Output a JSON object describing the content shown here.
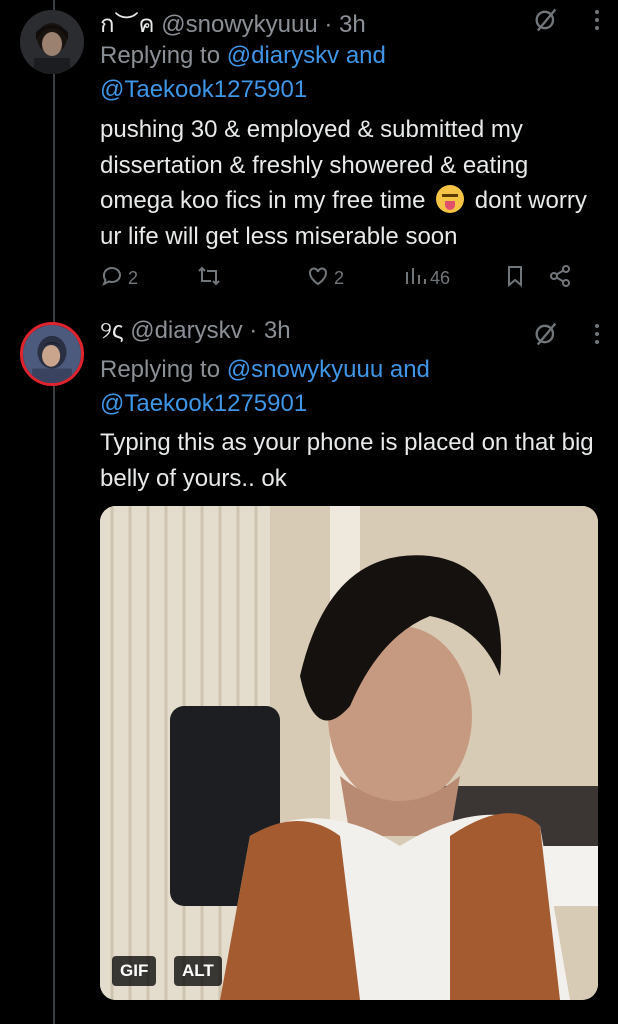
{
  "tweets": [
    {
      "display_name": "ก︶ค",
      "handle": "@snowykyuuu",
      "time": "· 3h",
      "replying_prefix": "Replying to",
      "replying_mention_1": "@diaryskv",
      "replying_and": "and",
      "replying_mention_2": "@Taekook1275901",
      "body_line1": "pushing 30 & employed & submitted my dissertation & freshly showered & eating omega koo fics in my free time",
      "body_line2": "dont worry ur life will get less miserable soon",
      "replies": "2",
      "likes": "2",
      "views": "46"
    },
    {
      "display_name": "୨ς",
      "handle": "@diaryskv",
      "time": "· 3h",
      "replying_prefix": "Replying to",
      "replying_mention_1": "@snowykyuuu",
      "replying_and": "and",
      "replying_mention_2": "@Taekook1275901",
      "body": "Typing this as your phone is placed on that big belly of yours.. ok",
      "media_badges": [
        "GIF",
        "ALT"
      ]
    }
  ],
  "icons": [
    "reply-icon",
    "retweet-icon",
    "like-icon",
    "views-icon",
    "bookmark-icon",
    "share-icon",
    "grok-icon",
    "more-icon"
  ],
  "colors": {
    "background": "#000000",
    "text": "#e7e9ea",
    "muted": "#71767b",
    "link": "#3f96e6"
  }
}
